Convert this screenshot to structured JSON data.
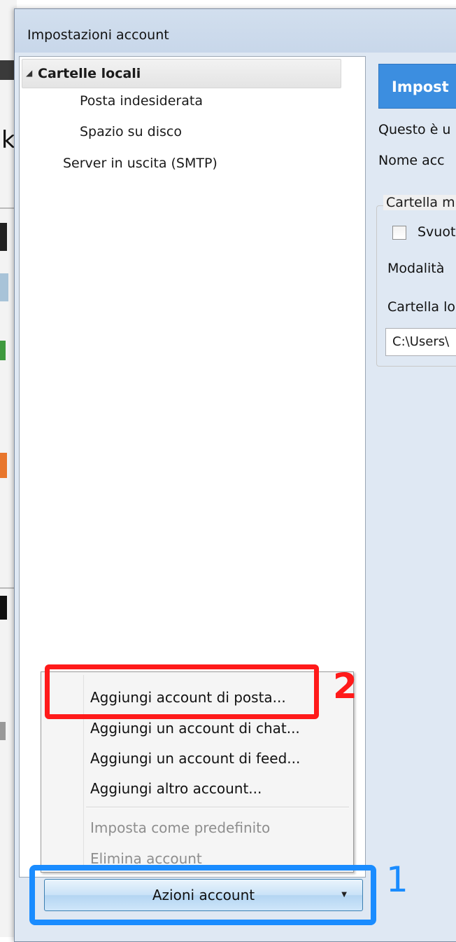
{
  "window": {
    "title": "Impostazioni account"
  },
  "tree": {
    "items": [
      {
        "label": "Cartelle locali",
        "expanded": true,
        "selected": true
      },
      {
        "label": "Posta indesiderata"
      },
      {
        "label": "Spazio su disco"
      },
      {
        "label": "Server in uscita (SMTP)"
      }
    ]
  },
  "menu": {
    "items": [
      {
        "label": "Aggiungi account di posta...",
        "enabled": true
      },
      {
        "label": "Aggiungi un account di chat...",
        "enabled": true
      },
      {
        "label": "Aggiungi un account di feed...",
        "enabled": true
      },
      {
        "label": "Aggiungi altro account...",
        "enabled": true
      },
      {
        "label": "Imposta come predefinito",
        "enabled": false
      },
      {
        "label": "Elimina account",
        "enabled": false
      }
    ]
  },
  "action_button": {
    "label": "Azioni account"
  },
  "panel": {
    "header": "Impost",
    "line1": "Questo è u",
    "account_name_label": "Nome acc",
    "group_label": "Cartella m",
    "checkbox_label": "Svuot",
    "mode_label": "Modalità",
    "local_folder_label": "Cartella lo",
    "path_value": "C:\\Users\\"
  },
  "annotations": {
    "step1": "1",
    "step2": "2"
  },
  "colors": {
    "highlight_red": "#ff1a1a",
    "highlight_blue": "#1a8cff",
    "panel_header": "#3c8ee0"
  }
}
